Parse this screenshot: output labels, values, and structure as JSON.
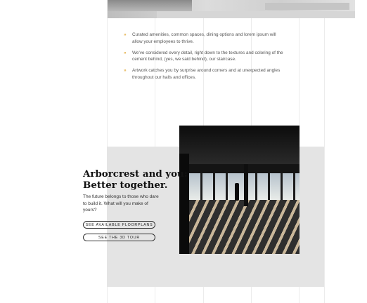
{
  "top_banner": {
    "image": "architectural-interior-photo"
  },
  "features": {
    "bullet_icon": "double-chevron-icon",
    "bullet_color": "#e2a93b",
    "items": [
      "Curated amenities, common spaces, dining options and lorem ipsum will allow your employees to thrive.",
      "We've considered every detail, right down to the textures and coloring of the cement behind, (yes, we said behind), our staircase.",
      "Artwork catches you by surprise around corners and at unexpected angles throughout our halls and offices."
    ]
  },
  "promo": {
    "headline_line1": "Arborcrest and you:",
    "headline_line2": "Better together.",
    "body": "The future belongs to those who dare to build it. What will you make of yours?",
    "button_floorplans": "SEE AVAILABLE FLOORPLANS",
    "button_tour": "SEE THE 3D TOUR",
    "photo": "office-interior-silhouette-photo"
  },
  "colors": {
    "panel_background": "#e4e4e4",
    "accent": "#e2a93b",
    "text": "#111111"
  }
}
